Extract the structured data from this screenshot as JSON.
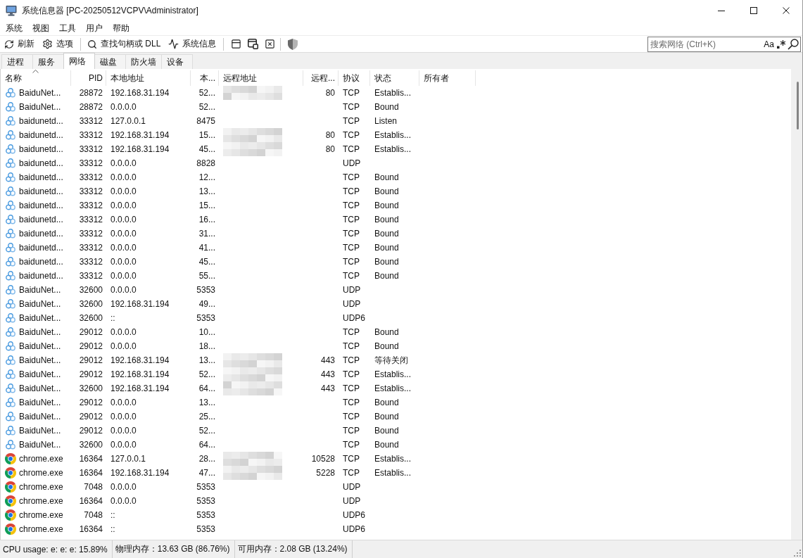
{
  "window": {
    "title": "系统信息器 [PC-20250512VCPV\\Administrator]"
  },
  "menu": [
    "系统",
    "视图",
    "工具",
    "用户",
    "帮助"
  ],
  "toolbar": {
    "buttons": [
      {
        "label": "刷新"
      },
      {
        "label": "选项"
      },
      {
        "label": "查找句柄或 DLL"
      },
      {
        "label": "系统信息"
      }
    ]
  },
  "search": {
    "placeholder": "搜索网络 (Ctrl+K)",
    "case_button": "Aa"
  },
  "tabs": [
    {
      "label": "进程",
      "selected": false
    },
    {
      "label": "服务",
      "selected": false
    },
    {
      "label": "网络",
      "selected": true
    },
    {
      "label": "磁盘",
      "selected": false
    },
    {
      "label": "防火墙",
      "selected": false
    },
    {
      "label": "设备",
      "selected": false
    }
  ],
  "table": {
    "columns": [
      {
        "label": "名称",
        "sorted": true
      },
      {
        "label": "PID",
        "sorted": false
      },
      {
        "label": "本地地址",
        "sorted": false
      },
      {
        "label": "本...",
        "sorted": false
      },
      {
        "label": "远程地址",
        "sorted": false
      },
      {
        "label": "远程...",
        "sorted": false
      },
      {
        "label": "协议",
        "sorted": false
      },
      {
        "label": "状态",
        "sorted": false
      },
      {
        "label": "所有者",
        "sorted": false
      }
    ],
    "rows": [
      {
        "kind": "netdisk",
        "name": "BaiduNet...",
        "pid": "28872",
        "local_address": "192.168.31.194",
        "local_port": "52...",
        "remote_blurred": true,
        "remote_port": "80",
        "protocol": "TCP",
        "state": "Establis..."
      },
      {
        "kind": "netdisk",
        "name": "BaiduNet...",
        "pid": "28872",
        "local_address": "0.0.0.0",
        "local_port": "52...",
        "remote_blurred": false,
        "protocol": "TCP",
        "state": "Bound"
      },
      {
        "kind": "netdisk",
        "name": "baidunetd...",
        "pid": "33312",
        "local_address": "127.0.0.1",
        "local_port": "8475",
        "remote_blurred": false,
        "protocol": "TCP",
        "state": "Listen"
      },
      {
        "kind": "netdisk",
        "name": "baidunetd...",
        "pid": "33312",
        "local_address": "192.168.31.194",
        "local_port": "15...",
        "remote_blurred": true,
        "remote_port": "80",
        "protocol": "TCP",
        "state": "Establis..."
      },
      {
        "kind": "netdisk",
        "name": "baidunetd...",
        "pid": "33312",
        "local_address": "192.168.31.194",
        "local_port": "45...",
        "remote_blurred": true,
        "remote_port": "80",
        "protocol": "TCP",
        "state": "Establis..."
      },
      {
        "kind": "netdisk",
        "name": "baidunetd...",
        "pid": "33312",
        "local_address": "0.0.0.0",
        "local_port": "8828",
        "remote_blurred": false,
        "protocol": "UDP"
      },
      {
        "kind": "netdisk",
        "name": "baidunetd...",
        "pid": "33312",
        "local_address": "0.0.0.0",
        "local_port": "12...",
        "remote_blurred": false,
        "protocol": "TCP",
        "state": "Bound"
      },
      {
        "kind": "netdisk",
        "name": "baidunetd...",
        "pid": "33312",
        "local_address": "0.0.0.0",
        "local_port": "13...",
        "remote_blurred": false,
        "protocol": "TCP",
        "state": "Bound"
      },
      {
        "kind": "netdisk",
        "name": "baidunetd...",
        "pid": "33312",
        "local_address": "0.0.0.0",
        "local_port": "15...",
        "remote_blurred": false,
        "protocol": "TCP",
        "state": "Bound"
      },
      {
        "kind": "netdisk",
        "name": "baidunetd...",
        "pid": "33312",
        "local_address": "0.0.0.0",
        "local_port": "16...",
        "remote_blurred": false,
        "protocol": "TCP",
        "state": "Bound"
      },
      {
        "kind": "netdisk",
        "name": "baidunetd...",
        "pid": "33312",
        "local_address": "0.0.0.0",
        "local_port": "31...",
        "remote_blurred": false,
        "protocol": "TCP",
        "state": "Bound"
      },
      {
        "kind": "netdisk",
        "name": "baidunetd...",
        "pid": "33312",
        "local_address": "0.0.0.0",
        "local_port": "41...",
        "remote_blurred": false,
        "protocol": "TCP",
        "state": "Bound"
      },
      {
        "kind": "netdisk",
        "name": "baidunetd...",
        "pid": "33312",
        "local_address": "0.0.0.0",
        "local_port": "45...",
        "remote_blurred": false,
        "protocol": "TCP",
        "state": "Bound"
      },
      {
        "kind": "netdisk",
        "name": "baidunetd...",
        "pid": "33312",
        "local_address": "0.0.0.0",
        "local_port": "55...",
        "remote_blurred": false,
        "protocol": "TCP",
        "state": "Bound"
      },
      {
        "kind": "netdisk",
        "name": "BaiduNet...",
        "pid": "32600",
        "local_address": "0.0.0.0",
        "local_port": "5353",
        "remote_blurred": false,
        "protocol": "UDP"
      },
      {
        "kind": "netdisk",
        "name": "BaiduNet...",
        "pid": "32600",
        "local_address": "192.168.31.194",
        "local_port": "49...",
        "remote_blurred": false,
        "protocol": "UDP"
      },
      {
        "kind": "netdisk",
        "name": "BaiduNet...",
        "pid": "32600",
        "local_address": "::",
        "local_port": "5353",
        "remote_blurred": false,
        "protocol": "UDP6"
      },
      {
        "kind": "netdisk",
        "name": "BaiduNet...",
        "pid": "29012",
        "local_address": "0.0.0.0",
        "local_port": "10...",
        "remote_blurred": false,
        "protocol": "TCP",
        "state": "Bound"
      },
      {
        "kind": "netdisk",
        "name": "BaiduNet...",
        "pid": "29012",
        "local_address": "0.0.0.0",
        "local_port": "18...",
        "remote_blurred": false,
        "protocol": "TCP",
        "state": "Bound"
      },
      {
        "kind": "netdisk",
        "name": "BaiduNet...",
        "pid": "29012",
        "local_address": "192.168.31.194",
        "local_port": "13...",
        "remote_blurred": true,
        "remote_port": "443",
        "protocol": "TCP",
        "state": "等待关闭"
      },
      {
        "kind": "netdisk",
        "name": "BaiduNet...",
        "pid": "29012",
        "local_address": "192.168.31.194",
        "local_port": "52...",
        "remote_blurred": true,
        "remote_port": "443",
        "protocol": "TCP",
        "state": "Establis..."
      },
      {
        "kind": "netdisk",
        "name": "BaiduNet...",
        "pid": "32600",
        "local_address": "192.168.31.194",
        "local_port": "64...",
        "remote_blurred": true,
        "remote_port": "443",
        "protocol": "TCP",
        "state": "Establis..."
      },
      {
        "kind": "netdisk",
        "name": "BaiduNet...",
        "pid": "29012",
        "local_address": "0.0.0.0",
        "local_port": "13...",
        "remote_blurred": false,
        "protocol": "TCP",
        "state": "Bound"
      },
      {
        "kind": "netdisk",
        "name": "BaiduNet...",
        "pid": "29012",
        "local_address": "0.0.0.0",
        "local_port": "25...",
        "remote_blurred": false,
        "protocol": "TCP",
        "state": "Bound"
      },
      {
        "kind": "netdisk",
        "name": "BaiduNet...",
        "pid": "29012",
        "local_address": "0.0.0.0",
        "local_port": "52...",
        "remote_blurred": false,
        "protocol": "TCP",
        "state": "Bound"
      },
      {
        "kind": "netdisk",
        "name": "BaiduNet...",
        "pid": "32600",
        "local_address": "0.0.0.0",
        "local_port": "64...",
        "remote_blurred": false,
        "protocol": "TCP",
        "state": "Bound"
      },
      {
        "kind": "browser",
        "name": "chrome.exe",
        "pid": "16364",
        "local_address": "127.0.0.1",
        "local_port": "28...",
        "remote_blurred": true,
        "remote_port": "10528",
        "protocol": "TCP",
        "state": "Establis..."
      },
      {
        "kind": "browser",
        "name": "chrome.exe",
        "pid": "16364",
        "local_address": "192.168.31.194",
        "local_port": "47...",
        "remote_blurred": true,
        "remote_port": "5228",
        "protocol": "TCP",
        "state": "Establis..."
      },
      {
        "kind": "browser",
        "name": "chrome.exe",
        "pid": "7048",
        "local_address": "0.0.0.0",
        "local_port": "5353",
        "remote_blurred": false,
        "protocol": "UDP"
      },
      {
        "kind": "browser",
        "name": "chrome.exe",
        "pid": "16364",
        "local_address": "0.0.0.0",
        "local_port": "5353",
        "remote_blurred": false,
        "protocol": "UDP"
      },
      {
        "kind": "browser",
        "name": "chrome.exe",
        "pid": "7048",
        "local_address": "::",
        "local_port": "5353",
        "remote_blurred": false,
        "protocol": "UDP6"
      },
      {
        "kind": "browser",
        "name": "chrome.exe",
        "pid": "16364",
        "local_address": "::",
        "local_port": "5353",
        "remote_blurred": false,
        "protocol": "UDP6"
      }
    ]
  },
  "status_bar": [
    "CPU usage: e: e: e: 15.89%",
    "物理内存：13.63 GB (86.76%)",
    "可用内存：2.08 GB (13.24%)"
  ]
}
